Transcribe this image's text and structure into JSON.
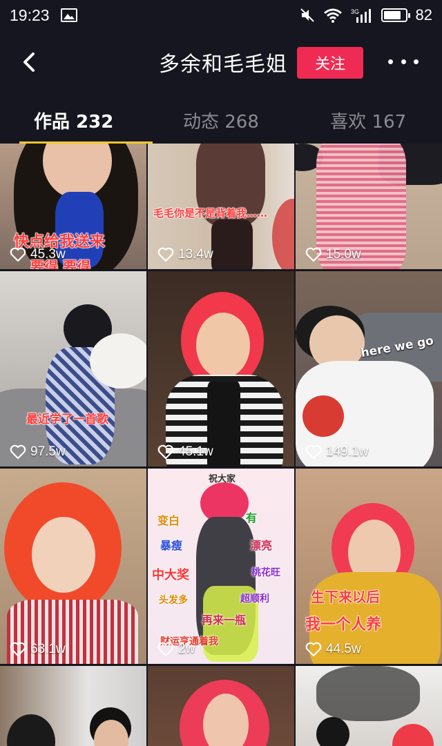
{
  "status": {
    "time": "19:23",
    "network": "3G",
    "battery": "82",
    "battery_level": 0.82
  },
  "nav": {
    "title": "多余和毛毛姐",
    "follow_label": "关注"
  },
  "tabs": [
    {
      "label": "作品 232",
      "active": true
    },
    {
      "label": "动态 268",
      "active": false
    },
    {
      "label": "喜欢 167",
      "active": false
    }
  ],
  "videos": [
    {
      "likes": "45.3w",
      "caption": "快点给我送来",
      "caption2": "要得 要得"
    },
    {
      "likes": "13.4w",
      "caption": "毛毛你是不是背着我……"
    },
    {
      "likes": "15.0w"
    },
    {
      "likes": "97.5w",
      "caption": "最近学了一首歌"
    },
    {
      "likes": "45.1w"
    },
    {
      "likes": "149.1w",
      "caption": "here we go"
    },
    {
      "likes": "63.1w"
    },
    {
      "likes": "2w",
      "caption": "祝大家",
      "stickers": [
        "变白",
        "有",
        "暴瘦",
        "漂亮",
        "中大奖",
        "桃花旺",
        "头发多",
        "超顺利",
        "再来一瓶",
        "财运亨通着我"
      ]
    },
    {
      "likes": "44.5w",
      "caption": "生下来以后",
      "caption2": "我一个人养"
    },
    {},
    {},
    {}
  ],
  "colors": {
    "accent": "#f02b53",
    "tab_underline": "#f3c730",
    "background": "#15161f"
  }
}
